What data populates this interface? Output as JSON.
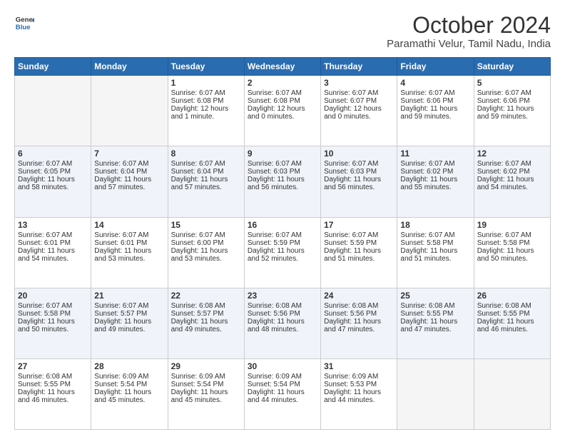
{
  "header": {
    "logo_line1": "General",
    "logo_line2": "Blue",
    "month": "October 2024",
    "location": "Paramathi Velur, Tamil Nadu, India"
  },
  "days_of_week": [
    "Sunday",
    "Monday",
    "Tuesday",
    "Wednesday",
    "Thursday",
    "Friday",
    "Saturday"
  ],
  "weeks": [
    [
      {
        "day": "",
        "content": ""
      },
      {
        "day": "",
        "content": ""
      },
      {
        "day": "1",
        "content": "Sunrise: 6:07 AM\nSunset: 6:08 PM\nDaylight: 12 hours\nand 1 minute."
      },
      {
        "day": "2",
        "content": "Sunrise: 6:07 AM\nSunset: 6:08 PM\nDaylight: 12 hours\nand 0 minutes."
      },
      {
        "day": "3",
        "content": "Sunrise: 6:07 AM\nSunset: 6:07 PM\nDaylight: 12 hours\nand 0 minutes."
      },
      {
        "day": "4",
        "content": "Sunrise: 6:07 AM\nSunset: 6:06 PM\nDaylight: 11 hours\nand 59 minutes."
      },
      {
        "day": "5",
        "content": "Sunrise: 6:07 AM\nSunset: 6:06 PM\nDaylight: 11 hours\nand 59 minutes."
      }
    ],
    [
      {
        "day": "6",
        "content": "Sunrise: 6:07 AM\nSunset: 6:05 PM\nDaylight: 11 hours\nand 58 minutes."
      },
      {
        "day": "7",
        "content": "Sunrise: 6:07 AM\nSunset: 6:04 PM\nDaylight: 11 hours\nand 57 minutes."
      },
      {
        "day": "8",
        "content": "Sunrise: 6:07 AM\nSunset: 6:04 PM\nDaylight: 11 hours\nand 57 minutes."
      },
      {
        "day": "9",
        "content": "Sunrise: 6:07 AM\nSunset: 6:03 PM\nDaylight: 11 hours\nand 56 minutes."
      },
      {
        "day": "10",
        "content": "Sunrise: 6:07 AM\nSunset: 6:03 PM\nDaylight: 11 hours\nand 56 minutes."
      },
      {
        "day": "11",
        "content": "Sunrise: 6:07 AM\nSunset: 6:02 PM\nDaylight: 11 hours\nand 55 minutes."
      },
      {
        "day": "12",
        "content": "Sunrise: 6:07 AM\nSunset: 6:02 PM\nDaylight: 11 hours\nand 54 minutes."
      }
    ],
    [
      {
        "day": "13",
        "content": "Sunrise: 6:07 AM\nSunset: 6:01 PM\nDaylight: 11 hours\nand 54 minutes."
      },
      {
        "day": "14",
        "content": "Sunrise: 6:07 AM\nSunset: 6:01 PM\nDaylight: 11 hours\nand 53 minutes."
      },
      {
        "day": "15",
        "content": "Sunrise: 6:07 AM\nSunset: 6:00 PM\nDaylight: 11 hours\nand 53 minutes."
      },
      {
        "day": "16",
        "content": "Sunrise: 6:07 AM\nSunset: 5:59 PM\nDaylight: 11 hours\nand 52 minutes."
      },
      {
        "day": "17",
        "content": "Sunrise: 6:07 AM\nSunset: 5:59 PM\nDaylight: 11 hours\nand 51 minutes."
      },
      {
        "day": "18",
        "content": "Sunrise: 6:07 AM\nSunset: 5:58 PM\nDaylight: 11 hours\nand 51 minutes."
      },
      {
        "day": "19",
        "content": "Sunrise: 6:07 AM\nSunset: 5:58 PM\nDaylight: 11 hours\nand 50 minutes."
      }
    ],
    [
      {
        "day": "20",
        "content": "Sunrise: 6:07 AM\nSunset: 5:58 PM\nDaylight: 11 hours\nand 50 minutes."
      },
      {
        "day": "21",
        "content": "Sunrise: 6:07 AM\nSunset: 5:57 PM\nDaylight: 11 hours\nand 49 minutes."
      },
      {
        "day": "22",
        "content": "Sunrise: 6:08 AM\nSunset: 5:57 PM\nDaylight: 11 hours\nand 49 minutes."
      },
      {
        "day": "23",
        "content": "Sunrise: 6:08 AM\nSunset: 5:56 PM\nDaylight: 11 hours\nand 48 minutes."
      },
      {
        "day": "24",
        "content": "Sunrise: 6:08 AM\nSunset: 5:56 PM\nDaylight: 11 hours\nand 47 minutes."
      },
      {
        "day": "25",
        "content": "Sunrise: 6:08 AM\nSunset: 5:55 PM\nDaylight: 11 hours\nand 47 minutes."
      },
      {
        "day": "26",
        "content": "Sunrise: 6:08 AM\nSunset: 5:55 PM\nDaylight: 11 hours\nand 46 minutes."
      }
    ],
    [
      {
        "day": "27",
        "content": "Sunrise: 6:08 AM\nSunset: 5:55 PM\nDaylight: 11 hours\nand 46 minutes."
      },
      {
        "day": "28",
        "content": "Sunrise: 6:09 AM\nSunset: 5:54 PM\nDaylight: 11 hours\nand 45 minutes."
      },
      {
        "day": "29",
        "content": "Sunrise: 6:09 AM\nSunset: 5:54 PM\nDaylight: 11 hours\nand 45 minutes."
      },
      {
        "day": "30",
        "content": "Sunrise: 6:09 AM\nSunset: 5:54 PM\nDaylight: 11 hours\nand 44 minutes."
      },
      {
        "day": "31",
        "content": "Sunrise: 6:09 AM\nSunset: 5:53 PM\nDaylight: 11 hours\nand 44 minutes."
      },
      {
        "day": "",
        "content": ""
      },
      {
        "day": "",
        "content": ""
      }
    ]
  ]
}
